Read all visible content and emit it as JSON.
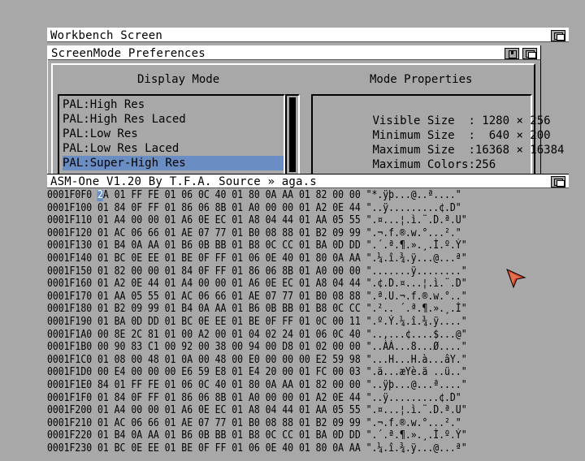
{
  "workbench": {
    "title": "Workbench Screen"
  },
  "prefs": {
    "title": "ScreenMode Preferences",
    "display_mode_heading": "Display Mode",
    "mode_properties_heading": "Mode Properties",
    "modes": [
      "PAL:High Res",
      "PAL:High Res Laced",
      "PAL:Low Res",
      "PAL:Low Res Laced",
      "PAL:Super-High Res"
    ],
    "selected_mode_index": 4,
    "properties": [
      {
        "label": "Visible Size  :",
        "value": " 1280 × 256"
      },
      {
        "label": "Minimum Size  :",
        "value": "  640 × 200"
      },
      {
        "label": "Maximum Size  :",
        "value": "16368 × 16384"
      },
      {
        "label": "Maximum Colors:",
        "value": "256"
      }
    ]
  },
  "asm": {
    "title": "ASM-One V1.20 By T.F.A. Source » aga.s",
    "cursor_char": "2",
    "rows": [
      {
        "addr": "0001F0F0",
        "hex": "2A 01 FF FE 01 06 0C 40 01 80 0A AA 01 82 00 00",
        "ascii": "\"*.ÿþ...@..ª....\""
      },
      {
        "addr": "0001F100",
        "hex": "01 84 0F FF 01 86 06 8B 01 A0 00 00 01 A2 0E 44",
        "ascii": "\"..ÿ.........¢.D\""
      },
      {
        "addr": "0001F110",
        "hex": "01 A4 00 00 01 A6 0E EC 01 A8 04 44 01 AA 05 55",
        "ascii": "\".¤...¦.ì.¨.D.ª.U\""
      },
      {
        "addr": "0001F120",
        "hex": "01 AC 06 66 01 AE 07 77 01 B0 08 88 01 B2 09 99",
        "ascii": "\".¬.f.®.w.°...².\""
      },
      {
        "addr": "0001F130",
        "hex": "01 B4 0A AA 01 B6 0B BB 01 B8 0C CC 01 BA 0D DD",
        "ascii": "\".´.ª.¶.».¸.Ì.º.Ý\""
      },
      {
        "addr": "0001F140",
        "hex": "01 BC 0E EE 01 BE 0F FF 01 06 0E 40 01 80 0A AA",
        "ascii": "\".¼.î.¾.ÿ...@...ª\""
      },
      {
        "addr": "0001F150",
        "hex": "01 82 00 00 01 84 0F FF 01 86 06 8B 01 A0 00 00",
        "ascii": "\".......ÿ........\""
      },
      {
        "addr": "0001F160",
        "hex": "01 A2 0E 44 01 A4 00 00 01 A6 0E EC 01 A8 04 44",
        "ascii": "\".¢.D.¤...¦.ì.¨.D\""
      },
      {
        "addr": "0001F170",
        "hex": "01 AA 05 55 01 AC 06 66 01 AE 07 77 01 B0 08 88",
        "ascii": "\".ª.U.¬.f.®.w.°..\""
      },
      {
        "addr": "0001F180",
        "hex": "01 B2 09 99 01 B4 0A AA 01 B6 0B BB 01 B8 0C CC",
        "ascii": "\".².. ´.ª.¶.».¸.Ì\""
      },
      {
        "addr": "0001F190",
        "hex": "01 BA 0D DD 01 BC 0E EE 01 BE 0F FF 01 0C 00 11",
        "ascii": "\".º.Ý.¼.î.¾.ÿ....\""
      },
      {
        "addr": "0001F1A0",
        "hex": "00 8E 2C 81 01 00 A2 00 01 04 02 24 01 06 0C 40",
        "ascii": "\"..,...¢....$...@\""
      },
      {
        "addr": "0001F1B0",
        "hex": "00 90 83 C1 00 92 00 38 00 94 00 D8 01 02 00 00",
        "ascii": "\"..ÀÁ...8...Ø....\""
      },
      {
        "addr": "0001F1C0",
        "hex": "01 08 00 48 01 0A 00 48 00 E0 00 00 00 E2 59 98",
        "ascii": "\"...H...H.à...âY.\""
      },
      {
        "addr": "0001F1D0",
        "hex": "00 E4 00 00 00 E6 59 E8 01 E4 20 00 01 FC 00 03",
        "ascii": "\".ä...æYè.ä ..ü..\""
      },
      {
        "addr": "0001F1E0",
        "hex": "84 01 FF FE 01 06 0C 40 01 80 0A AA 01 82 00 00",
        "ascii": "\"..ÿþ...@...ª....\""
      },
      {
        "addr": "0001F1F0",
        "hex": "01 84 0F FF 01 86 06 8B 01 A0 00 00 01 A2 0E 44",
        "ascii": "\"..ÿ.........¢.D\""
      },
      {
        "addr": "0001F200",
        "hex": "01 A4 00 00 01 A6 0E EC 01 A8 04 44 01 AA 05 55",
        "ascii": "\".¤...¦.ì.¨.D.ª.U\""
      },
      {
        "addr": "0001F210",
        "hex": "01 AC 06 66 01 AE 07 77 01 B0 08 88 01 B2 09 99",
        "ascii": "\".¬.f.®.w.°...².\""
      },
      {
        "addr": "0001F220",
        "hex": "01 B4 0A AA 01 B6 0B BB 01 B8 0C CC 01 BA 0D DD",
        "ascii": "\".´.ª.¶.».¸.Ì.º.Ý\""
      },
      {
        "addr": "0001F230",
        "hex": "01 BC 0E EE 01 BE 0F FF 01 06 0E 40 01 80 0A AA",
        "ascii": "\".¼.î.¾.ÿ...@...ª\""
      }
    ]
  },
  "colors": {
    "background": "#a8a8a8",
    "titlebar": "#ffffff",
    "selection": "#6a8ec4",
    "pointer": "#d04020"
  }
}
